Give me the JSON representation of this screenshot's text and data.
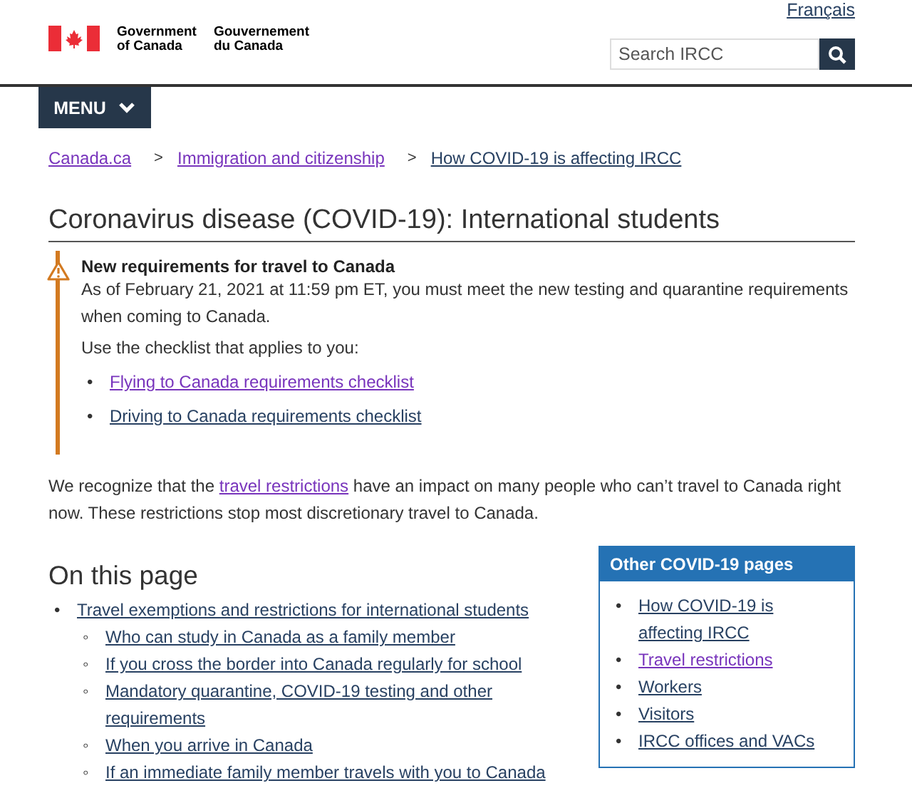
{
  "header": {
    "gov_en": [
      "Government",
      "of Canada"
    ],
    "gov_fr": [
      "Gouvernement",
      "du Canada"
    ],
    "language_link": "Français",
    "search": {
      "placeholder": "Search IRCC"
    }
  },
  "menu_button": "MENU",
  "breadcrumb": [
    {
      "label": "Canada.ca",
      "visited": true
    },
    {
      "label": "Immigration and citizenship",
      "visited": true
    },
    {
      "label": "How COVID-19 is affecting IRCC",
      "visited": false
    }
  ],
  "breadcrumb_separator": ">",
  "title": "Coronavirus disease (COVID-19): International students",
  "alert": {
    "heading": "New requirements for travel to Canada",
    "text": "As of February 21, 2021 at 11:59 pm ET, you must meet the new testing and quarantine requirements when coming to Canada.",
    "prompt": "Use the checklist that applies to you:",
    "links": [
      {
        "bullet": "•",
        "label": "Flying to Canada requirements checklist",
        "visited": true
      },
      {
        "bullet": "•",
        "label": "Driving to Canada requirements checklist",
        "visited": false
      }
    ]
  },
  "intro": {
    "before": "We recognize that the",
    "link": {
      "label": "travel restrictions",
      "visited": true
    },
    "after": "have an impact on many people who can’t travel to Canada right now. These restrictions stop most discretionary travel to Canada."
  },
  "on_this_page": {
    "heading": "On this page",
    "items": [
      {
        "bullet": "•",
        "label": "Travel exemptions and restrictions for international students",
        "visited": false,
        "children": [
          {
            "bullet": "◦",
            "label": "Who can study in Canada as a family member",
            "visited": false
          },
          {
            "bullet": "◦",
            "label": "If you cross the border into Canada regularly for school",
            "visited": false
          },
          {
            "bullet": "◦",
            "label": "Mandatory quarantine, COVID-19 testing and other requirements",
            "visited": false
          },
          {
            "bullet": "◦",
            "label": "When you arrive in Canada",
            "visited": false
          },
          {
            "bullet": "◦",
            "label": "If an immediate family member travels with you to Canada",
            "visited": false
          }
        ]
      }
    ]
  },
  "other_pages": {
    "heading": "Other COVID-19 pages",
    "links": [
      {
        "bullet": "•",
        "label": "How COVID-19 is affecting IRCC",
        "visited": false
      },
      {
        "bullet": "•",
        "label": "Travel restrictions",
        "visited": true
      },
      {
        "bullet": "•",
        "label": "Workers",
        "visited": false
      },
      {
        "bullet": "•",
        "label": "Visitors",
        "visited": false
      },
      {
        "bullet": "•",
        "label": "IRCC offices and VACs",
        "visited": false
      }
    ]
  }
}
